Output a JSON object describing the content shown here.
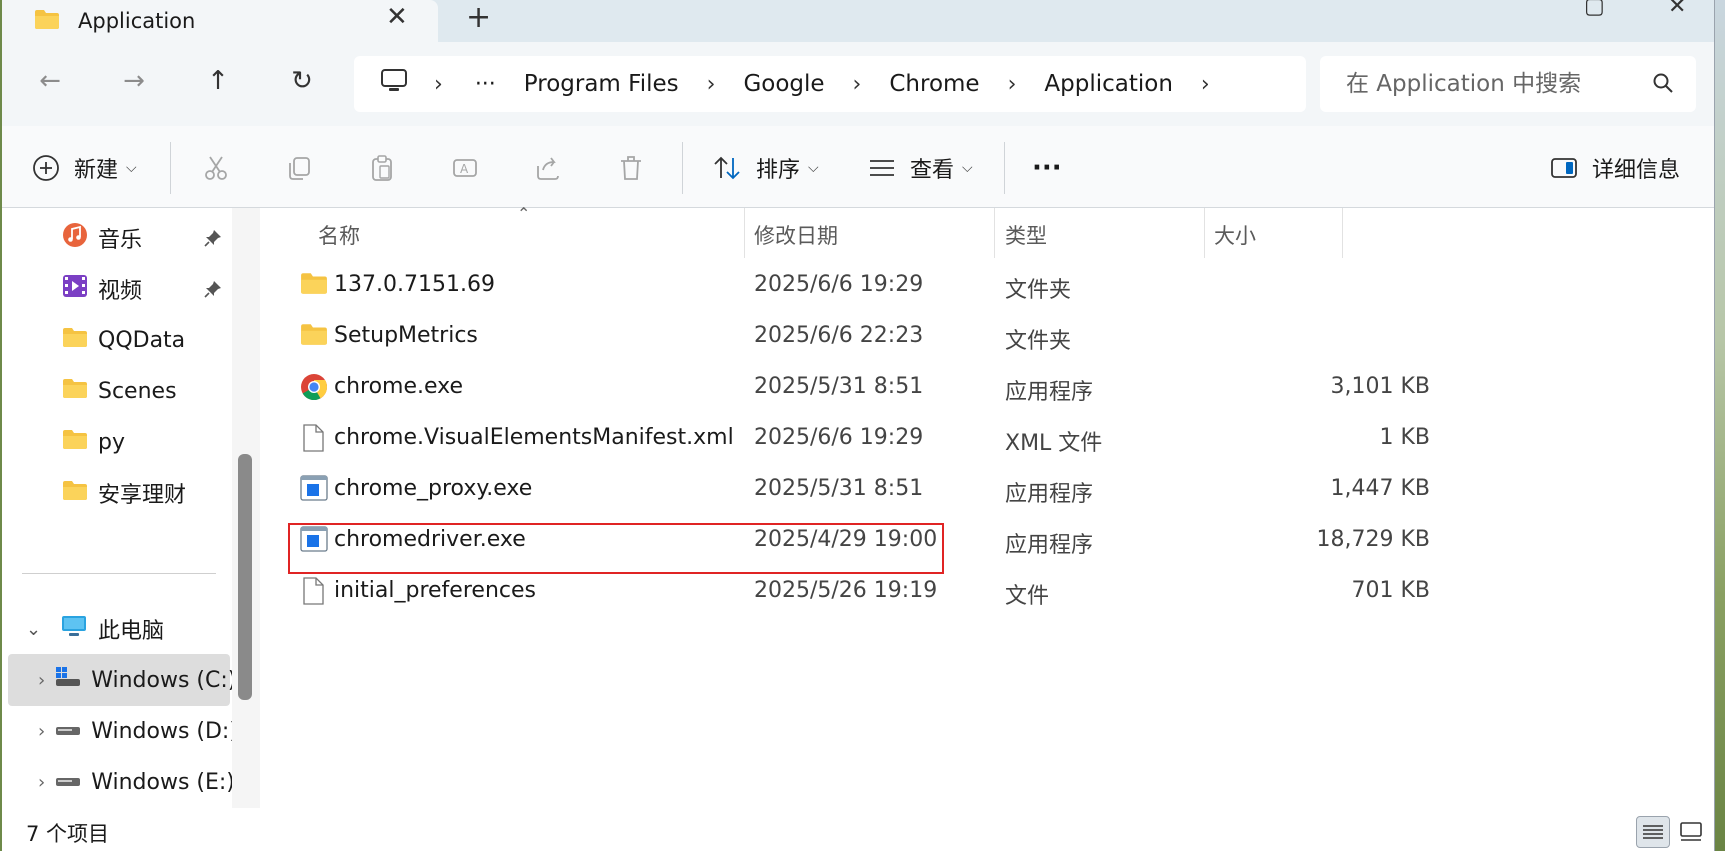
{
  "window": {
    "tab_title": "Application"
  },
  "navbar": {
    "breadcrumb": [
      "Program Files",
      "Google",
      "Chrome",
      "Application"
    ],
    "ellipsis": "···",
    "search_placeholder": "在 Application 中搜索"
  },
  "toolbar": {
    "new_label": "新建",
    "sort_label": "排序",
    "view_label": "查看",
    "more_label": "···",
    "details_label": "详细信息"
  },
  "sidebar": {
    "quick_access": [
      {
        "label": "音乐",
        "icon": "music-icon",
        "pinned": true
      },
      {
        "label": "视频",
        "icon": "video-icon",
        "pinned": true
      },
      {
        "label": "QQData",
        "icon": "folder-icon",
        "pinned": false
      },
      {
        "label": "Scenes",
        "icon": "folder-icon",
        "pinned": false
      },
      {
        "label": "py",
        "icon": "folder-icon",
        "pinned": false
      },
      {
        "label": "安享理财",
        "icon": "folder-icon",
        "pinned": false
      }
    ],
    "this_pc_label": "此电脑",
    "drives": [
      {
        "label": "Windows (C:)",
        "selected": true
      },
      {
        "label": "Windows (D:)",
        "selected": false
      },
      {
        "label": "Windows (E:)",
        "selected": false
      }
    ]
  },
  "columns": {
    "name": "名称",
    "date": "修改日期",
    "type": "类型",
    "size": "大小"
  },
  "files": [
    {
      "name": "137.0.7151.69",
      "date": "2025/6/6 19:29",
      "type": "文件夹",
      "size": "",
      "icon": "folder-icon"
    },
    {
      "name": "SetupMetrics",
      "date": "2025/6/6 22:23",
      "type": "文件夹",
      "size": "",
      "icon": "folder-icon"
    },
    {
      "name": "chrome.exe",
      "date": "2025/5/31 8:51",
      "type": "应用程序",
      "size": "3,101 KB",
      "icon": "chrome-icon"
    },
    {
      "name": "chrome.VisualElementsManifest.xml",
      "date": "2025/6/6 19:29",
      "type": "XML 文件",
      "size": "1 KB",
      "icon": "file-icon"
    },
    {
      "name": "chrome_proxy.exe",
      "date": "2025/5/31 8:51",
      "type": "应用程序",
      "size": "1,447 KB",
      "icon": "exe-icon"
    },
    {
      "name": "chromedriver.exe",
      "date": "2025/4/29 19:00",
      "type": "应用程序",
      "size": "18,729 KB",
      "icon": "exe-icon"
    },
    {
      "name": "initial_preferences",
      "date": "2025/5/26 19:19",
      "type": "文件",
      "size": "701 KB",
      "icon": "file-icon"
    }
  ],
  "status": {
    "item_count": "7 个项目"
  },
  "colors": {
    "highlight": "#e02424",
    "folder": "#f5c342",
    "accent": "#0067c0"
  }
}
